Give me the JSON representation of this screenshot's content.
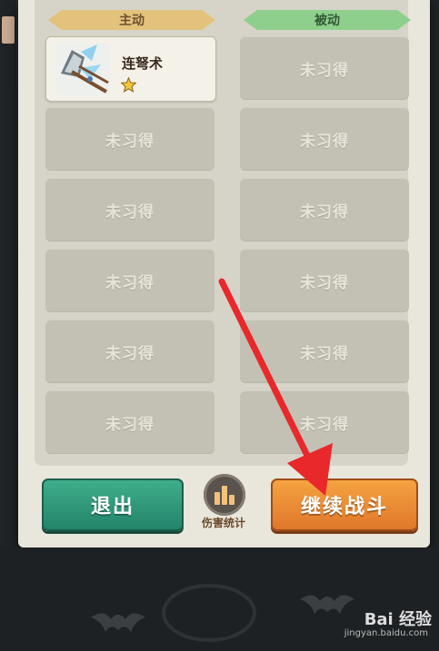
{
  "tabs": {
    "active_label": "主动",
    "passive_label": "被动"
  },
  "active_skills": [
    {
      "name": "连弩术",
      "learned": true,
      "stars": 1
    },
    {
      "name": "未习得",
      "learned": false
    },
    {
      "name": "未习得",
      "learned": false
    },
    {
      "name": "未习得",
      "learned": false
    },
    {
      "name": "未习得",
      "learned": false
    },
    {
      "name": "未习得",
      "learned": false
    }
  ],
  "passive_skills": [
    {
      "name": "未习得",
      "learned": false
    },
    {
      "name": "未习得",
      "learned": false
    },
    {
      "name": "未习得",
      "learned": false
    },
    {
      "name": "未习得",
      "learned": false
    },
    {
      "name": "未习得",
      "learned": false
    },
    {
      "name": "未习得",
      "learned": false
    }
  ],
  "buttons": {
    "exit_label": "退出",
    "damage_stats_label": "伤害统计",
    "continue_label": "继续战斗"
  },
  "colors": {
    "exit_green": "#2a9a78",
    "continue_orange": "#ec8d35",
    "arrow_red": "#e8282b"
  },
  "watermark": {
    "brand": "Bai 经验",
    "url": "jingyan.baidu.com"
  }
}
